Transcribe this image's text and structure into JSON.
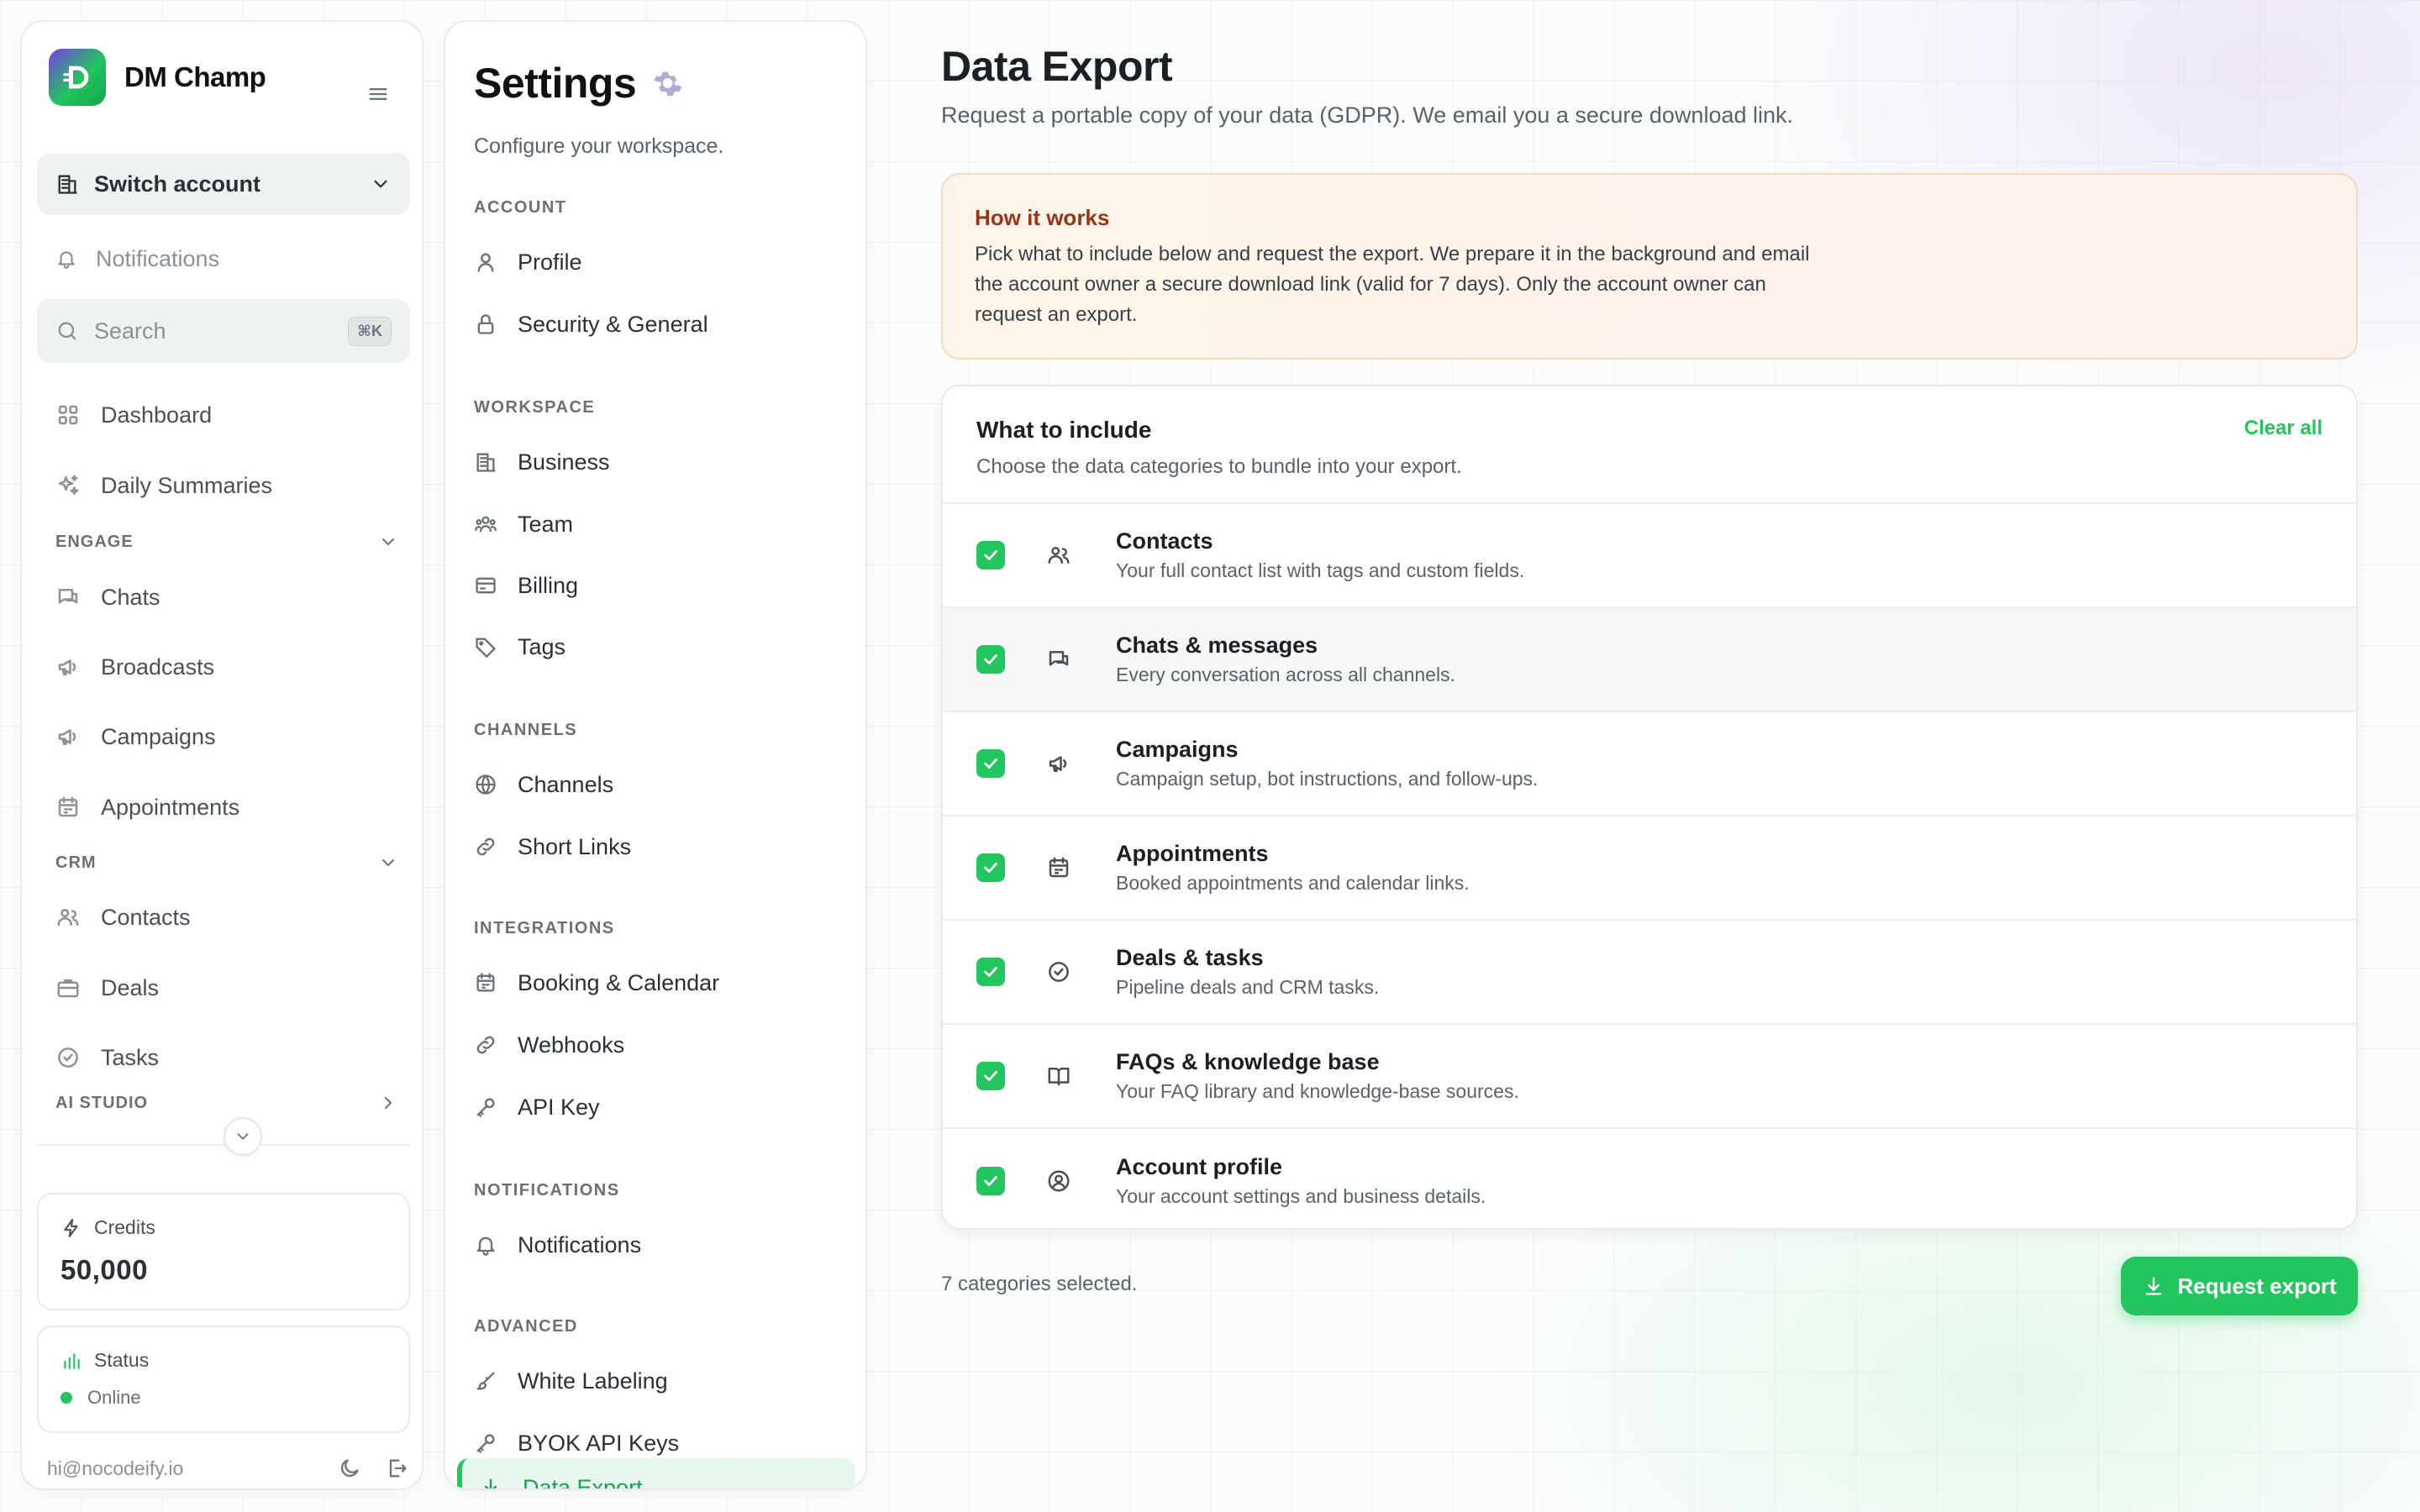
{
  "sidebar": {
    "brand_name": "DM Champ",
    "switch_account": "Switch account",
    "notifications": "Notifications",
    "search_placeholder": "Search",
    "search_shortcut": "⌘K",
    "items": {
      "dashboard": "Dashboard",
      "daily_summaries": "Daily Summaries",
      "chats": "Chats",
      "broadcasts": "Broadcasts",
      "campaigns": "Campaigns",
      "appointments": "Appointments",
      "contacts": "Contacts",
      "deals": "Deals",
      "tasks": "Tasks"
    },
    "groups": {
      "engage": "ENGAGE",
      "crm": "CRM",
      "ai_studio": "AI STUDIO"
    },
    "credits_label": "Credits",
    "credits_value": "50,000",
    "status_label": "Status",
    "status_value": "Online",
    "user_email": "hi@nocodeify.io"
  },
  "settings": {
    "title": "Settings",
    "subtitle": "Configure your workspace.",
    "groups": {
      "account": "ACCOUNT",
      "workspace": "WORKSPACE",
      "channels": "CHANNELS",
      "integrations": "INTEGRATIONS",
      "notifications": "NOTIFICATIONS",
      "advanced": "ADVANCED"
    },
    "items": {
      "profile": "Profile",
      "security": "Security & General",
      "business": "Business",
      "team": "Team",
      "billing": "Billing",
      "tags": "Tags",
      "channels": "Channels",
      "short_links": "Short Links",
      "booking": "Booking & Calendar",
      "webhooks": "Webhooks",
      "api_key": "API Key",
      "notifications": "Notifications",
      "white_labeling": "White Labeling",
      "byok": "BYOK API Keys",
      "data_export": "Data Export"
    }
  },
  "main": {
    "title": "Data Export",
    "subtitle": "Request a portable copy of your data (GDPR). We email you a secure download link.",
    "how_title": "How it works",
    "how_body": "Pick what to include below and request the export. We prepare it in the background and email the account owner a secure download link (valid for 7 days). Only the account owner can request an export.",
    "include_title": "What to include",
    "include_subtitle": "Choose the data categories to bundle into your export.",
    "clear_all": "Clear all",
    "categories": [
      {
        "title": "Contacts",
        "desc": "Your full contact list with tags and custom fields.",
        "checked": true
      },
      {
        "title": "Chats & messages",
        "desc": "Every conversation across all channels.",
        "checked": true
      },
      {
        "title": "Campaigns",
        "desc": "Campaign setup, bot instructions, and follow-ups.",
        "checked": true
      },
      {
        "title": "Appointments",
        "desc": "Booked appointments and calendar links.",
        "checked": true
      },
      {
        "title": "Deals & tasks",
        "desc": "Pipeline deals and CRM tasks.",
        "checked": true
      },
      {
        "title": "FAQs & knowledge base",
        "desc": "Your FAQ library and knowledge-base sources.",
        "checked": true
      },
      {
        "title": "Account profile",
        "desc": "Your account settings and business details.",
        "checked": true
      }
    ],
    "selected_count": "7 categories selected.",
    "request_button": "Request export"
  },
  "colors": {
    "accent": "#22c55e",
    "warning_title": "#9a3412",
    "warning_bg": "#fdf4ea"
  }
}
